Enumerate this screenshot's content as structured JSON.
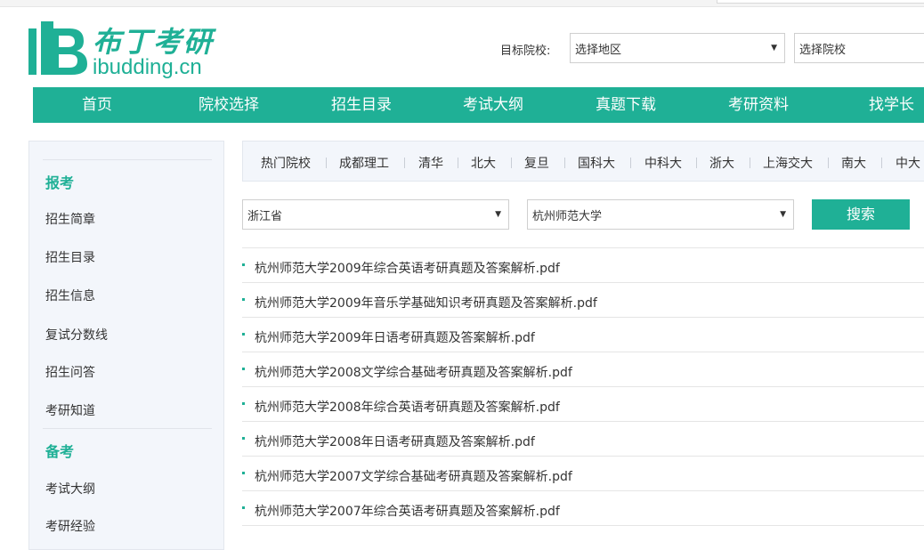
{
  "logo": {
    "brand_cn": "布丁考研",
    "brand_en": "ibudding.cn"
  },
  "target": {
    "label": "目标院校:",
    "region_select": "选择地区",
    "school_select": "选择院校"
  },
  "nav": [
    "首页",
    "院校选择",
    "招生目录",
    "考试大纲",
    "真题下载",
    "考研资料",
    "找学长"
  ],
  "sidebar": {
    "section1": "报考",
    "section1_items": [
      "招生简章",
      "招生目录",
      "招生信息",
      "复试分数线",
      "招生问答",
      "考研知道"
    ],
    "section2": "备考",
    "section2_items": [
      "考试大纲",
      "考研经验"
    ]
  },
  "hot_schools": [
    "热门院校",
    "成都理工",
    "清华",
    "北大",
    "复旦",
    "国科大",
    "中科大",
    "浙大",
    "上海交大",
    "南大",
    "中大"
  ],
  "filters": {
    "province": "浙江省",
    "university": "杭州师范大学",
    "search_label": "搜索"
  },
  "files": [
    "杭州师范大学2009年综合英语考研真题及答案解析.pdf",
    "杭州师范大学2009年音乐学基础知识考研真题及答案解析.pdf",
    "杭州师范大学2009年日语考研真题及答案解析.pdf",
    "杭州师范大学2008文学综合基础考研真题及答案解析.pdf",
    "杭州师范大学2008年综合英语考研真题及答案解析.pdf",
    "杭州师范大学2008年日语考研真题及答案解析.pdf",
    "杭州师范大学2007文学综合基础考研真题及答案解析.pdf",
    "杭州师范大学2007年综合英语考研真题及答案解析.pdf"
  ],
  "colors": {
    "accent": "#1fb096",
    "sidebar_bg": "#f3f6fb"
  }
}
